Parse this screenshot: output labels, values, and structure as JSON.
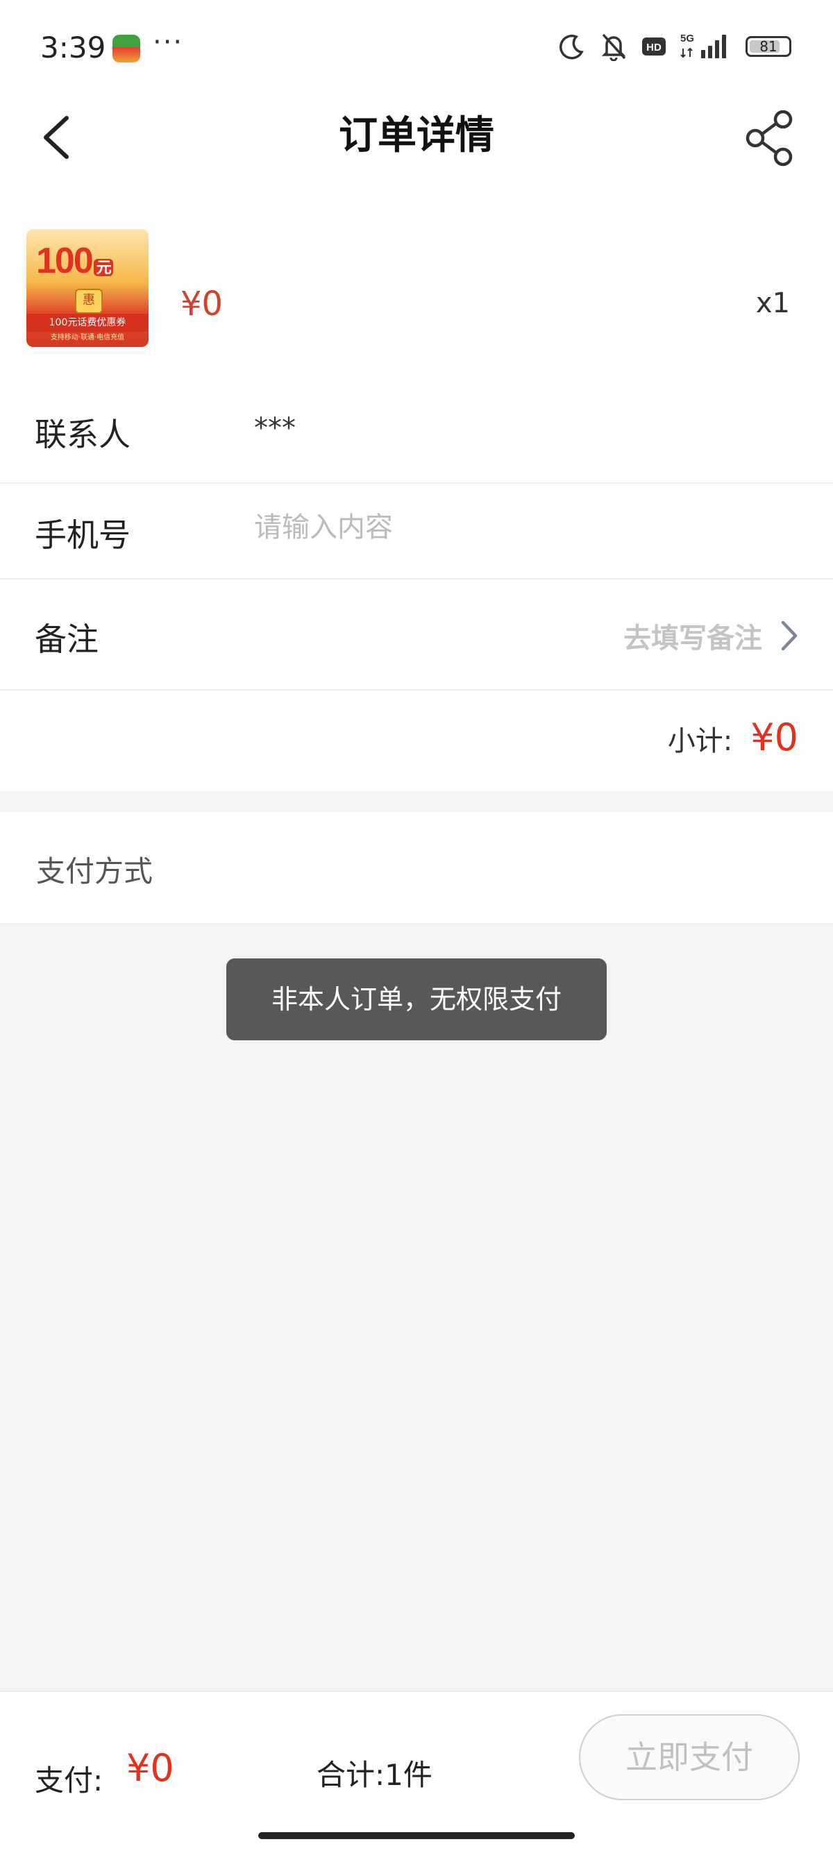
{
  "status_bar": {
    "time": "3:39",
    "more": "···",
    "battery": "81",
    "network": "5G",
    "hd": "HD",
    "icons": [
      "moon-icon",
      "mute-bell-icon",
      "hd-icon",
      "5g-icon",
      "signal-icon",
      "battery-icon"
    ]
  },
  "nav": {
    "title": "订单详情",
    "back_icon": "chevron-left-icon",
    "share_icon": "share-icon"
  },
  "product": {
    "image_text": {
      "amount": "100",
      "unit": "元",
      "seal": "惠",
      "band": "100元话费优惠券",
      "band_small": "支持移动·联通·电信充值"
    },
    "price": "¥0",
    "quantity": "x1"
  },
  "form": {
    "contact_label": "联系人",
    "contact_value": "***",
    "phone_label": "手机号",
    "phone_value": "",
    "phone_placeholder": "请输入内容",
    "remark_label": "备注",
    "remark_link": "去填写备注",
    "subtotal_label": "小计:",
    "subtotal_value": "¥0"
  },
  "payment": {
    "method_label": "支付方式"
  },
  "toast": {
    "message": "非本人订单，无权限支付"
  },
  "bottom_bar": {
    "pay_label": "支付:",
    "pay_value": "¥0",
    "total_label": "合计:1件",
    "pay_button": "立即支付"
  },
  "colors": {
    "accent_red": "#e0331f",
    "toast_bg": "#585858",
    "placeholder": "#bbbbbb"
  }
}
